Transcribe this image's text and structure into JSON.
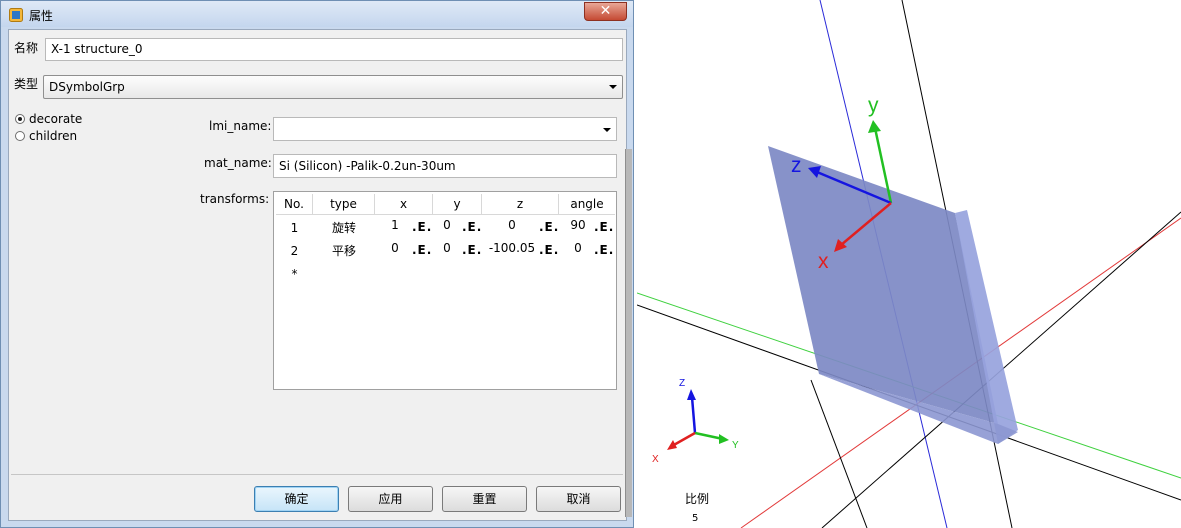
{
  "dialog": {
    "title": "属性",
    "close_glyph": "✕",
    "name_label": "名称",
    "name_value": "X-1 structure_0",
    "type_label": "类型",
    "type_value": "DSymbolGrp",
    "radios": [
      {
        "label": "decorate",
        "checked": true
      },
      {
        "label": "children",
        "checked": false
      }
    ],
    "lmi_name_label": "lmi_name:",
    "lmi_name_value": "",
    "mat_name_label": "mat_name:",
    "mat_name_value": "Si (Silicon) -Palik-0.2un-30um",
    "transforms_label": "transforms:",
    "table": {
      "columns": [
        "No.",
        "type",
        "x",
        "y",
        "z",
        "angle"
      ],
      "edit_button": ".E.",
      "rows": [
        {
          "no": "1",
          "type": "旋转",
          "x": "1",
          "y": "0",
          "z": "0",
          "angle": "90"
        },
        {
          "no": "2",
          "type": "平移",
          "x": "0",
          "y": "0",
          "z": "-100.05",
          "angle": "0"
        }
      ],
      "new_row_marker": "*"
    },
    "buttons": {
      "ok": "确定",
      "apply": "应用",
      "reset": "重置",
      "cancel": "取消"
    }
  },
  "viewport": {
    "axis_labels": {
      "x": "x",
      "y": "y",
      "z": "z"
    },
    "mini_axis_labels": {
      "x": "X",
      "y": "Y",
      "z": "Z"
    },
    "scale_label": "比例",
    "scale_value": "5",
    "colors": {
      "x_axis": "#e02020",
      "y_axis": "#22c022",
      "z_axis": "#1515e0",
      "slab_face": "#7d89c4",
      "slab_side": "#97a3dd"
    }
  }
}
